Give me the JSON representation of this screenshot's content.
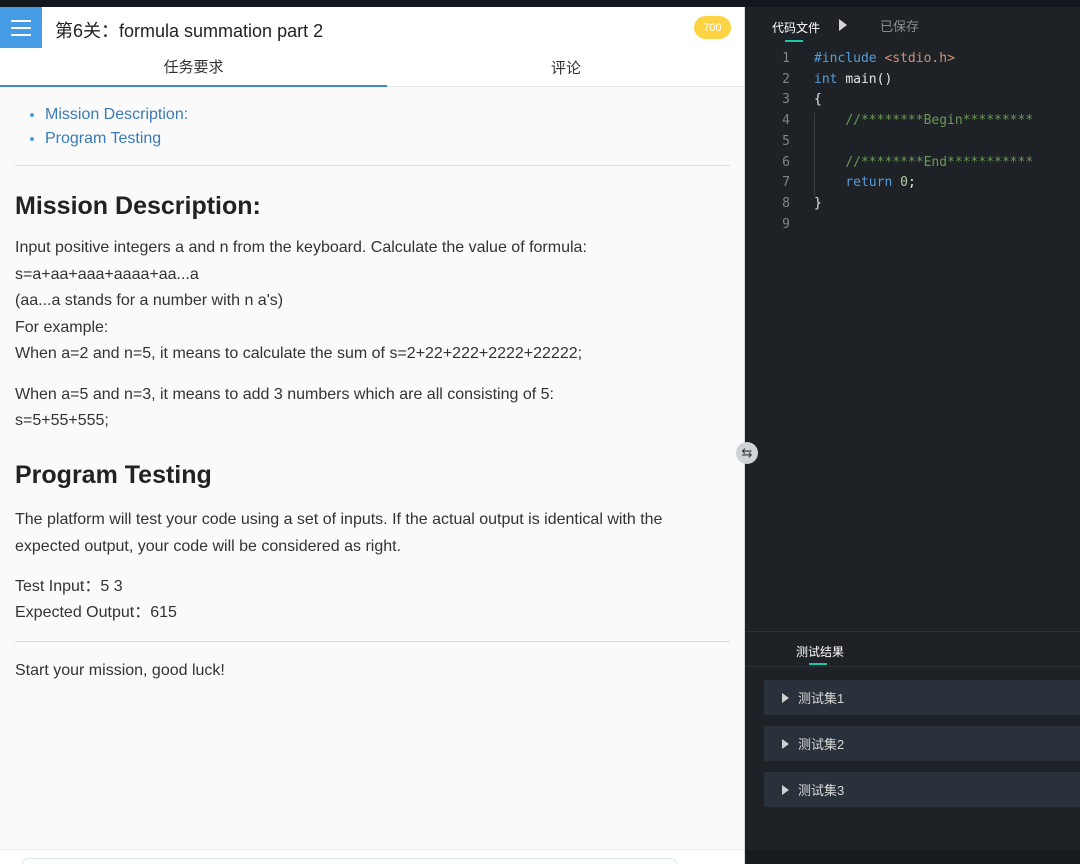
{
  "header": {
    "title": "第6关：formula summation part 2",
    "badge": "700"
  },
  "tabs": [
    {
      "label": "任务要求"
    },
    {
      "label": "评论"
    }
  ],
  "toc": [
    "Mission Description:",
    "Program Testing"
  ],
  "sections": {
    "mission_title": "Mission Description:",
    "mission_para": [
      "Input positive integers a and n from the keyboard. Calculate the value of formula:",
      "s=a+aa+aaa+aaaa+aa...a",
      "(aa...a stands for a number with n a's)",
      "For example:",
      "When a=2 and n=5, it means to calculate the sum of s=2+22+222+2222+22222;"
    ],
    "mission_para2": [
      "When a=5 and n=3, it means to add 3 numbers which are all consisting of 5:",
      "s=5+55+555;"
    ],
    "testing_title": "Program Testing",
    "testing_para": "The platform will test your code using a set of inputs. If the actual output is identical with the expected output, your code will be considered as right.",
    "test_input": "Test Input：5 3",
    "expected_output": "Expected Output：615",
    "closing": "Start your mission, good luck!"
  },
  "editor": {
    "tab_label": "代码文件",
    "saved_label": "已保存",
    "lines": [
      {
        "n": "1",
        "parts": [
          [
            "kw",
            "#include "
          ],
          [
            "str",
            "<stdio.h>"
          ]
        ]
      },
      {
        "n": "2",
        "parts": [
          [
            "kw",
            "int "
          ],
          [
            "",
            "main()"
          ]
        ]
      },
      {
        "n": "3",
        "parts": [
          [
            "",
            "{"
          ]
        ]
      },
      {
        "n": "4",
        "parts": [
          [
            "",
            "    "
          ],
          [
            "cm",
            "//********Begin*********"
          ]
        ]
      },
      {
        "n": "5",
        "parts": [
          [
            "",
            ""
          ]
        ]
      },
      {
        "n": "6",
        "parts": [
          [
            "",
            "    "
          ],
          [
            "cm",
            "//********End***********"
          ]
        ]
      },
      {
        "n": "7",
        "parts": [
          [
            "",
            "    "
          ],
          [
            "kw",
            "return "
          ],
          [
            "num",
            "0"
          ],
          [
            "",
            ";"
          ]
        ]
      },
      {
        "n": "8",
        "parts": [
          [
            "",
            "}"
          ]
        ]
      },
      {
        "n": "9",
        "parts": [
          [
            "",
            ""
          ]
        ]
      }
    ]
  },
  "results": {
    "tab_label": "测试结果",
    "sets": [
      "测试集1",
      "测试集2",
      "测试集3"
    ]
  },
  "colors": {
    "accent": "#459be4",
    "badge": "#fbd343",
    "teal": "#1fc8a4"
  }
}
